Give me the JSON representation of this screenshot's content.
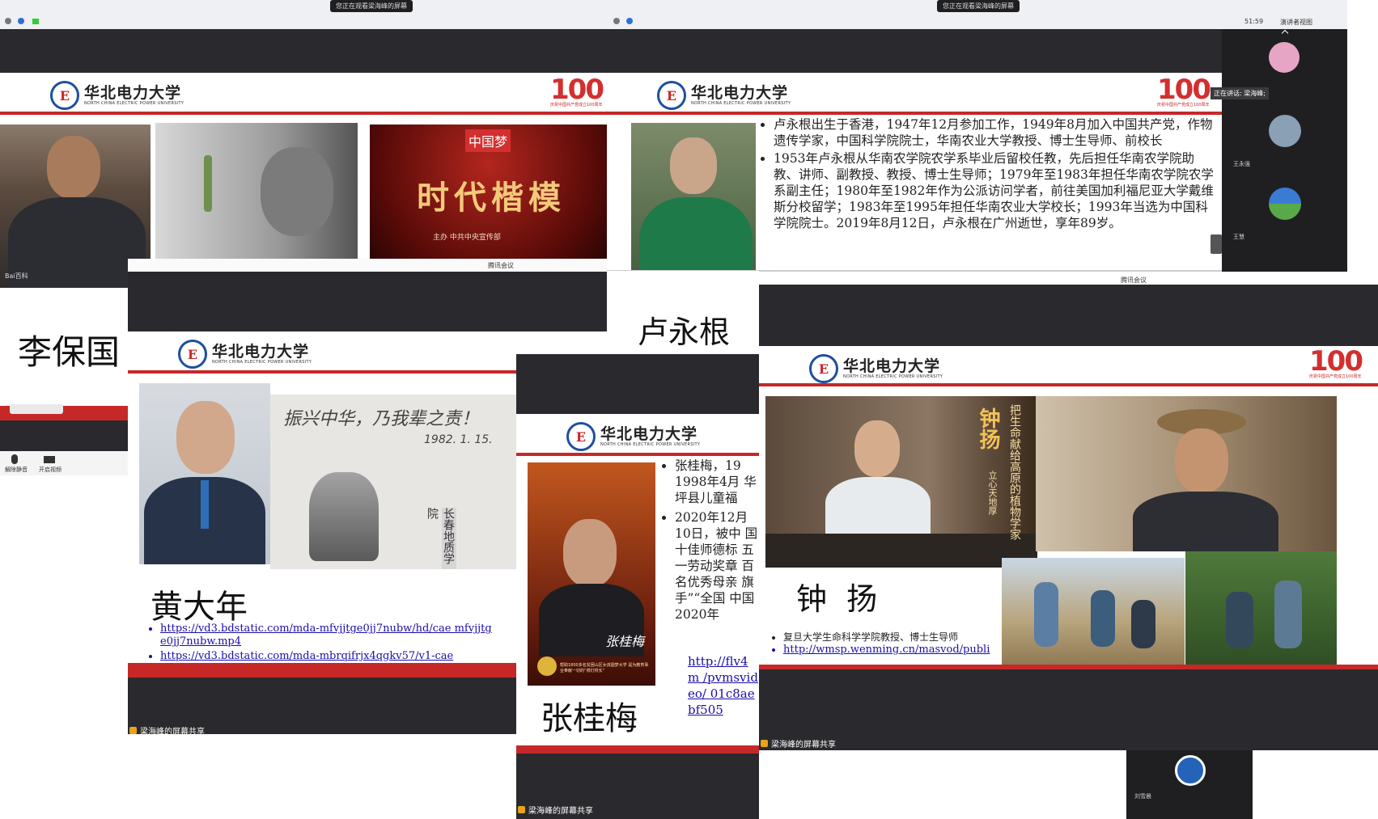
{
  "top": {
    "left_banner": "您正在观看梁海峰的屏幕",
    "right_banner": "您正在观看梁海峰的屏幕",
    "clock": "51:59",
    "view_mode": "演讲者视图"
  },
  "meeting_app_label": "腾讯会议",
  "share_label": "梁海峰的屏幕共享",
  "speaking_label": "正在讲话: 梁海峰;",
  "participants": [
    "王永强",
    "王慧",
    "刘雪晨"
  ],
  "controls": {
    "mute": "解除静音",
    "video": "开启视频"
  },
  "university": {
    "cn": "华北电力大学",
    "en": "NORTH CHINA ELECTRIC POWER UNIVERSITY"
  },
  "anniversary": {
    "number": "100",
    "text": "庆祝中国共产党成立100周年"
  },
  "slides": {
    "li": {
      "name": "李保国",
      "tv_top": "中国梦",
      "tv_title": "时代楷模",
      "tv_sub": "主办  中共中央宣传部",
      "watermark": "Bai百科"
    },
    "lu": {
      "name": "卢永根",
      "bullets": [
        "卢永根出生于香港，1947年12月参加工作，1949年8月加入中国共产党，作物遗传学家，中国科学院院士，华南农业大学教授、博士生导师、前校长",
        "1953年卢永根从华南农学院农学系毕业后留校任教，先后担任华南农学院助教、讲师、副教授、教授、博士生导师；1979年至1983年担任华南农学院农学系副主任；1980年至1982年作为公派访问学者，前往美国加利福尼亚大学戴维斯分校留学；1983年至1995年担任华南农业大学校长；1993年当选为中国科学院院士。2019年8月12日，卢永根在广州逝世，享年89岁。"
      ]
    },
    "huang": {
      "name": "黄大年",
      "handwriting": "振兴中华，乃我辈之责！",
      "handwriting_date": "1982. 1. 15.",
      "sign": "长春地质学院",
      "links": [
        "https://vd3.bdstatic.com/mda-mfvjjtge0jj7nubw/hd/cae mfvjjtge0jj7nubw.mp4",
        "https://vd3.bdstatic.com/mda-mbrqifrjx4qgkv57/v1-cae"
      ]
    },
    "zhang": {
      "name": "张桂梅",
      "bullets": [
        "张桂梅，19 1998年4月 华坪县儿童福",
        "2020年12月 10日，被中 国十佳师德标 五一劳动奖章 百名优秀母亲 旗手”“全国 中国2020年"
      ],
      "link": "http://flv4m /pvmsvideo/ 01c8aebf505",
      "photo_caption": "张桂梅",
      "photo_note": "帮助1800多名贫困山区女孩圆梦大学 是为教育事业奉献一切的“燃灯校长”"
    },
    "zhong": {
      "name": "钟  扬",
      "banner_title": "钟扬",
      "banner_col1": "把生命献给高原的植物学家",
      "banner_col2": "立心天地厚",
      "bullets": [
        "复旦大学生命科学学院教授、博士生导师"
      ],
      "link": "http://wmsp.wenming.cn/masvod/publi"
    }
  },
  "colors": {
    "brand_red": "#c62828",
    "meeting_dark": "#2a2a2e",
    "link_blue": "#1a0dab"
  }
}
